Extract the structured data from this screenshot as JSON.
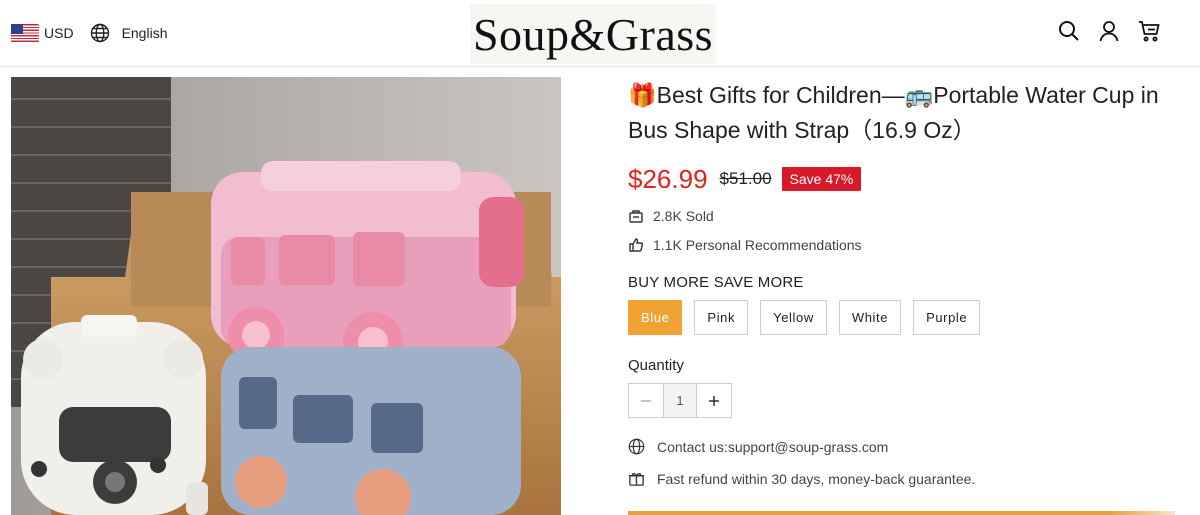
{
  "header": {
    "currency": "USD",
    "language": "English",
    "logo_text": "Soup&Grass",
    "icons": [
      "search-icon",
      "account-icon",
      "cart-icon"
    ]
  },
  "product": {
    "title": "🎁Best Gifts for Children—🚌Portable Water Cup in Bus Shape with Strap（16.9 Oz）",
    "price": "$26.99",
    "compare_price": "$51.00",
    "save_badge": "Save 47%",
    "sold": "2.8K Sold",
    "recommendations": "1.1K Personal Recommendations",
    "variant_label": "BUY MORE SAVE MORE",
    "options": [
      "Blue",
      "Pink",
      "Yellow",
      "White",
      "Purple"
    ],
    "selected_option": "Blue",
    "quantity_label": "Quantity",
    "quantity": "1",
    "contact": "Contact us:support@soup-grass.com",
    "refund": "Fast refund within 30 days, money-back guarantee."
  },
  "colors": {
    "accent": "#f0a233",
    "price": "#e4211b",
    "badge": "#d7192a"
  }
}
